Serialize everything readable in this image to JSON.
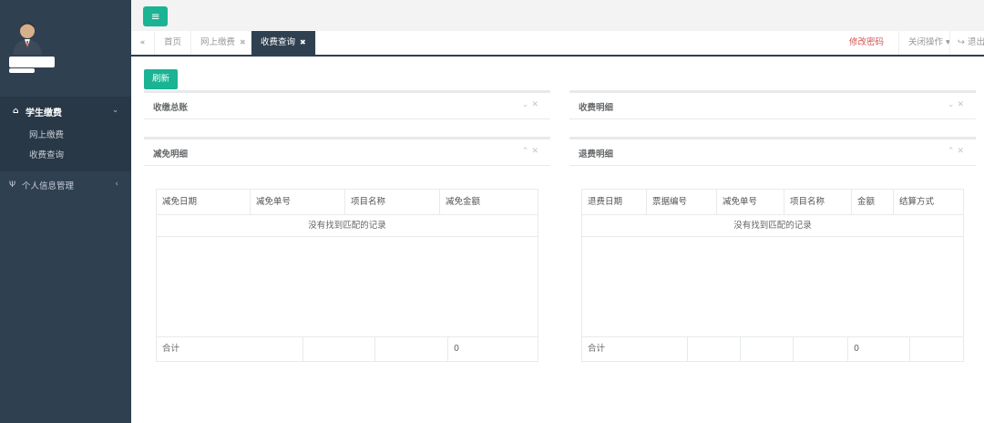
{
  "sidebar": {
    "menu": {
      "label": "学生缴费",
      "icon": "home-icon",
      "items": [
        {
          "label": "网上缴费"
        },
        {
          "label": "收费查询"
        }
      ]
    },
    "profile_menu": {
      "label": "个人信息管理",
      "icon": "cutlery-icon"
    }
  },
  "tabs": [
    {
      "label": "首页"
    },
    {
      "label": "网上缴费"
    },
    {
      "label": "收费查询"
    }
  ],
  "topnav": {
    "change_password": "修改密码",
    "close_ops": "关闭操作",
    "logout": "退出"
  },
  "toolbar": {
    "refresh": "刷新"
  },
  "panels": {
    "summary": {
      "title": "收缴总账"
    },
    "details": {
      "title": "收费明细"
    },
    "reduction": {
      "title": "减免明细"
    },
    "refund": {
      "title": "退费明细"
    }
  },
  "reduction_table": {
    "columns": [
      "减免日期",
      "减免单号",
      "项目名称",
      "减免金额"
    ],
    "empty": "没有找到匹配的记录",
    "footer": [
      "合计",
      "",
      "",
      "0"
    ]
  },
  "refund_table": {
    "columns": [
      "退费日期",
      "票据编号",
      "减免单号",
      "项目名称",
      "金额",
      "结算方式"
    ],
    "empty": "没有找到匹配的记录",
    "footer": [
      "合计",
      "",
      "",
      "",
      "0",
      ""
    ]
  },
  "colors": {
    "accent": "#1ab394",
    "sidebar": "#2f4050",
    "danger": "#d9534f"
  }
}
